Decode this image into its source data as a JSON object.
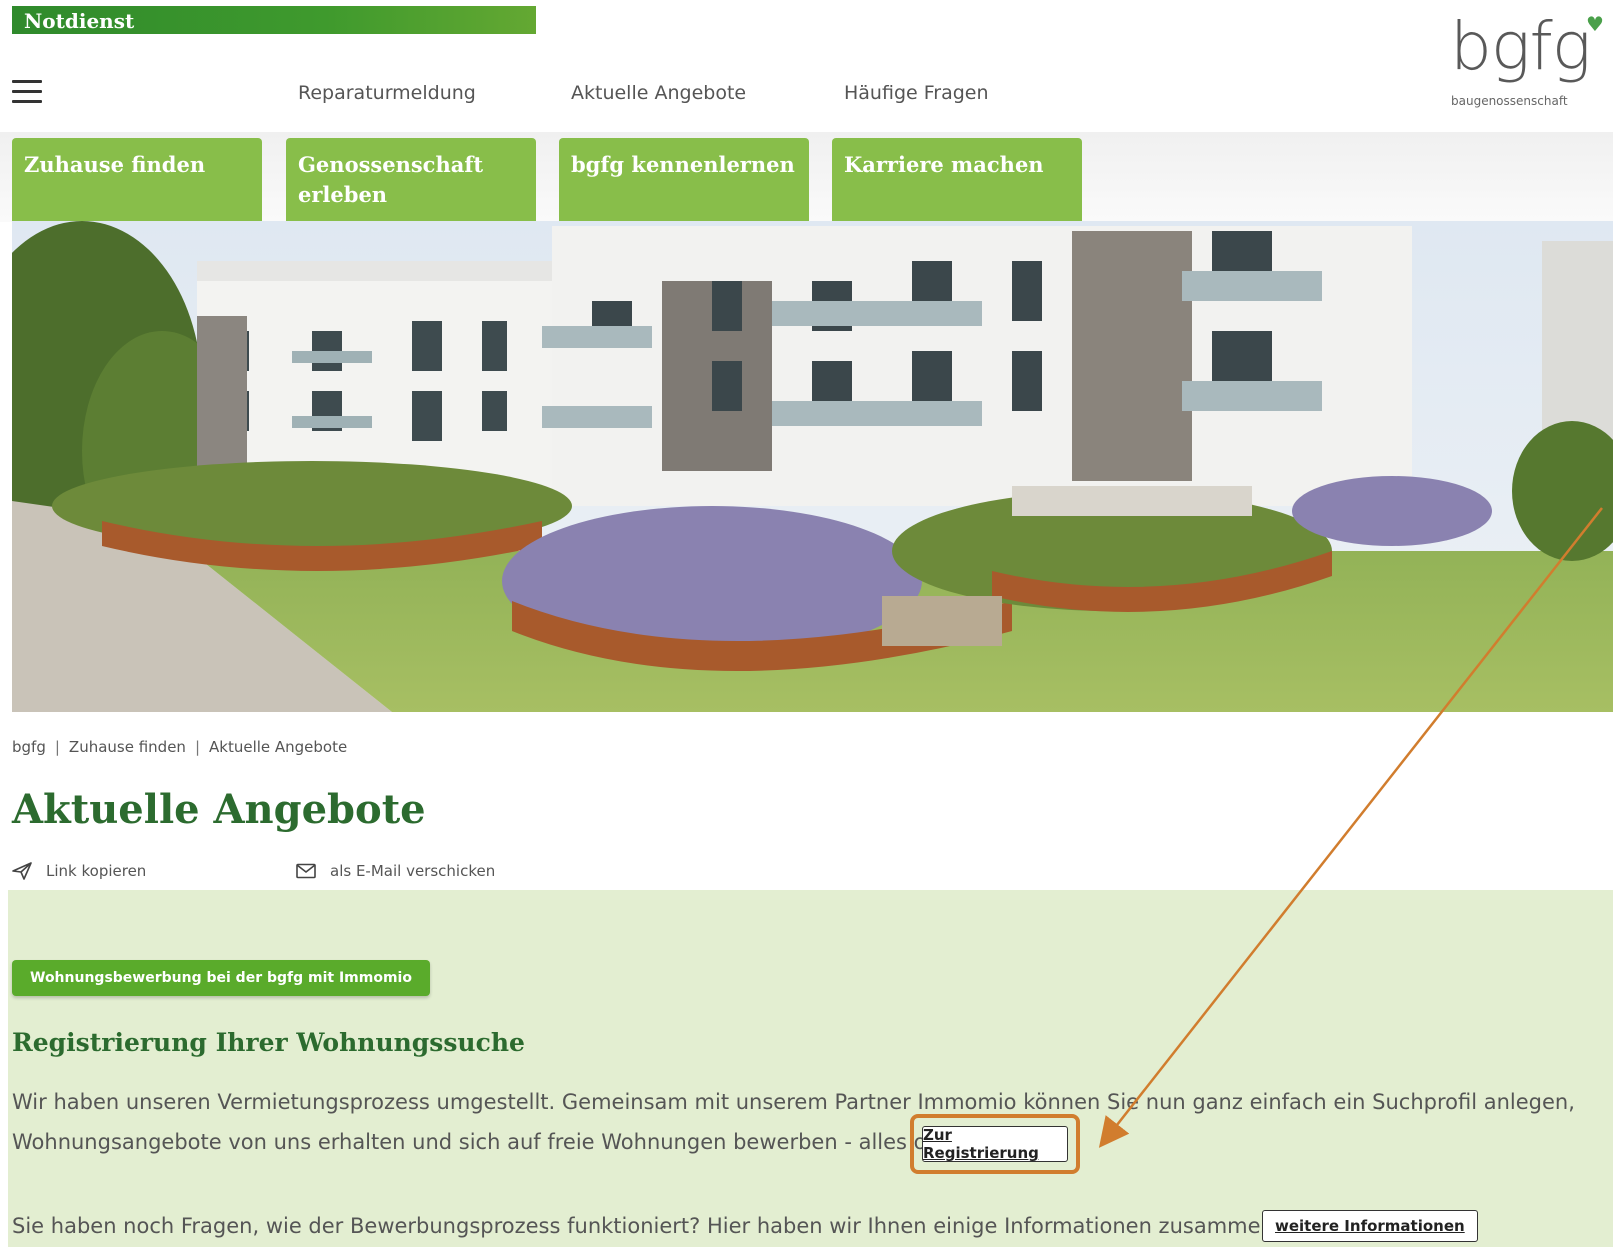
{
  "notdienst": {
    "label": "Notdienst"
  },
  "topnav": {
    "items": [
      "Reparaturmeldung",
      "Aktuelle Angebote",
      "Häufige Fragen"
    ]
  },
  "logo": {
    "text": "bgfg",
    "subtitle": "baugenossenschaft"
  },
  "main_tabs": [
    {
      "label_line1": "Zuhause finden",
      "label_line2": ""
    },
    {
      "label_line1": "Genossenschaft",
      "label_line2": "erleben"
    },
    {
      "label_line1": "bgfg kennenlernen",
      "label_line2": ""
    },
    {
      "label_line1": "Karriere machen",
      "label_line2": ""
    }
  ],
  "breadcrumb": [
    "bgfg",
    "Zuhause finden",
    "Aktuelle Angebote"
  ],
  "page_title": "Aktuelle Angebote",
  "share": {
    "copy_link": "Link kopieren",
    "email": "als E-Mail verschicken"
  },
  "content": {
    "pill_label": "Wohnungsbewerbung bei der bgfg mit Immomio",
    "section_title": "Registrierung Ihrer Wohnungssuche",
    "para1_line1": "Wir haben unseren Vermietungsprozess umgestellt. Gemeinsam mit unserem Partner Immomio können Sie nun ganz einfach ein Suchprofil anlegen,",
    "para1_line2": "Wohnungsangebote von uns erhalten und sich auf freie Wohnungen bewerben - alles online!",
    "register_button": "Zur Registrierung",
    "para2": "Sie haben noch Fragen, wie der Bewerbungsprozess funktioniert? Hier haben wir Ihnen einige Informationen zusammengestellt:",
    "more_info_button": "weitere Informationen"
  },
  "colors": {
    "brand_green_dark": "#2c6b2f",
    "tab_green": "#88be4a",
    "panel_green": "#e3eed1",
    "highlight_orange": "#d17d2e"
  }
}
